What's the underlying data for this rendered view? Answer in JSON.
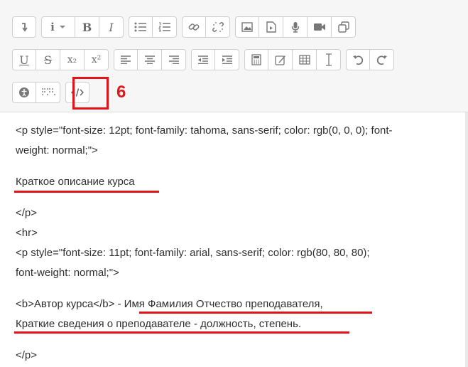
{
  "toolbar": {
    "rows": [
      [
        [
          "collapse-icon"
        ],
        [
          "paragraph-style-icon",
          "bold-icon",
          "italic-icon"
        ],
        [
          "bulleted-list-icon",
          "numbered-list-icon"
        ],
        [
          "link-icon",
          "unlink-icon"
        ],
        [
          "image-icon",
          "media-file-icon",
          "microphone-icon",
          "video-camera-icon",
          "copy-icon"
        ]
      ],
      [
        [
          "underline-icon",
          "strikethrough-icon",
          "subscript-icon",
          "superscript-icon"
        ],
        [
          "align-left-icon",
          "align-center-icon",
          "align-right-icon"
        ],
        [
          "outdent-icon",
          "indent-icon"
        ],
        [
          "equation-icon",
          "special-character-icon",
          "table-icon",
          "clear-formatting-icon"
        ],
        [
          "undo-icon",
          "redo-icon"
        ]
      ],
      [
        [
          "accessibility-checker-icon",
          "screenreader-helper-icon"
        ],
        [
          "html-source-icon"
        ]
      ]
    ],
    "labels": {
      "bold": "B",
      "italic": "I",
      "underline": "U",
      "strike": "S",
      "sub": "x₂",
      "sup": "x²",
      "para": "i"
    }
  },
  "annotation": {
    "step_number": "6",
    "highlight_color": "#e3131a"
  },
  "editor": {
    "lines": [
      "<p style=\"font-size: 12pt; font-family: tahoma, sans-serif; color: rgb(0, 0, 0); font-",
      "weight: normal;\">",
      "",
      "Краткое описание курса",
      "",
      "</p>",
      "<hr>",
      "<p style=\"font-size: 11pt; font-family: arial, sans-serif; color: rgb(80, 80, 80);",
      "font-weight: normal;\">",
      "",
      "<b>Автор курса</b> - Имя Фамилия Отчество преподавателя,",
      "Краткие сведения о преподавателе - должность, степень.",
      "",
      "</p>"
    ]
  }
}
